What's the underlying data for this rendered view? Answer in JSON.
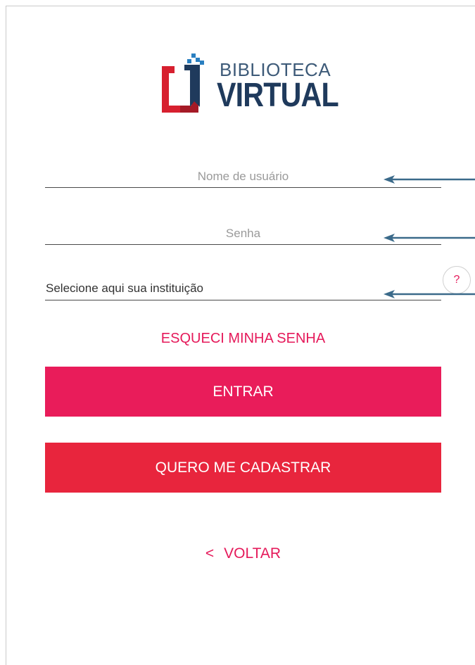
{
  "brand": {
    "line1": "BIBLIOTECA",
    "line2": "VIRTUAL",
    "colors": {
      "red": "#d7202f",
      "navy": "#1f3a5c",
      "blue": "#2a7fc0"
    }
  },
  "login": {
    "username_placeholder": "Nome de usuário",
    "password_placeholder": "Senha",
    "institution_label": "Selecione aqui sua instituição",
    "help_symbol": "?",
    "forgot_password": "ESQUECI MINHA SENHA",
    "enter_label": "ENTRAR",
    "register_label": "QUERO ME CADASTRAR",
    "back_symbol": "<",
    "back_label": "VOLTAR"
  },
  "colors": {
    "accent_pink": "#e91c5a",
    "accent_red": "#e8253d",
    "annotation_arrow": "#3b6a8a"
  }
}
